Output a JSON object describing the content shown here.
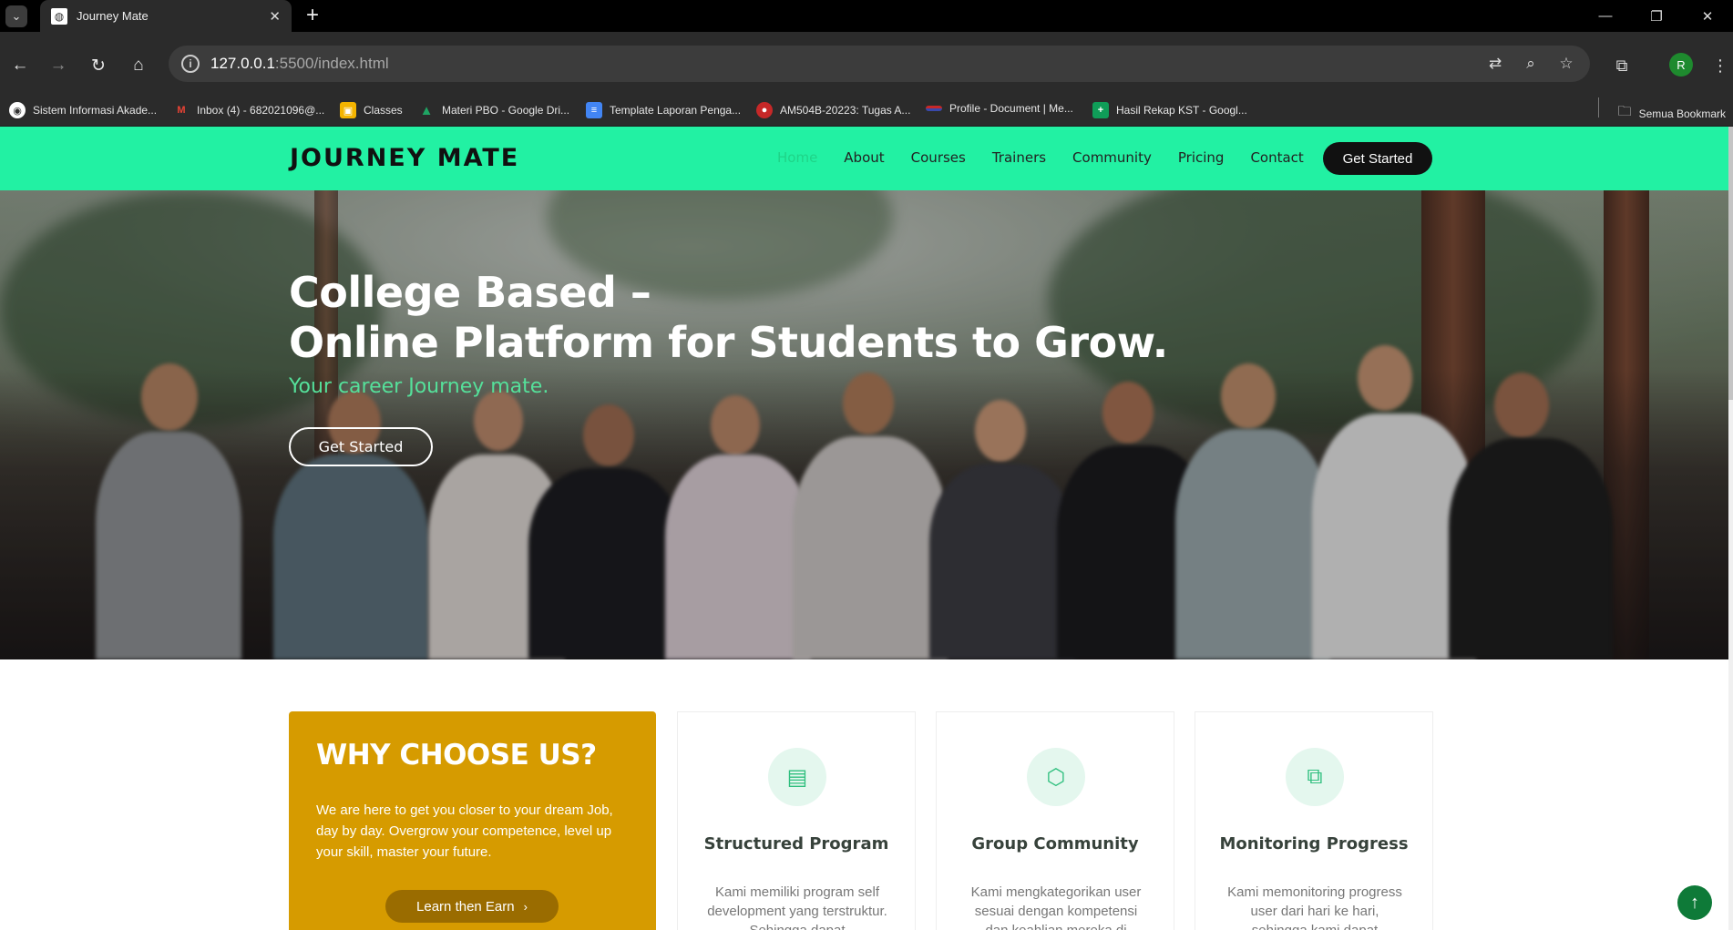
{
  "browser": {
    "tab_title": "Journey Mate",
    "url_host": "127.0.0.1",
    "url_rest": ":5500/index.html",
    "bookmarks": [
      {
        "label": "Sistem Informasi Akade...",
        "icon": "globe-icon",
        "color": "#ffffff"
      },
      {
        "label": "Inbox (4) - 682021096@...",
        "icon": "gmail-icon",
        "color": "#ea4335"
      },
      {
        "label": "Classes",
        "icon": "classroom-icon",
        "color": "#f4b400"
      },
      {
        "label": "Materi PBO - Google Dri...",
        "icon": "drive-icon",
        "color": "#1fa463"
      },
      {
        "label": "Template Laporan Penga...",
        "icon": "docs-icon",
        "color": "#4285f4"
      },
      {
        "label": "AM504B-20223: Tugas A...",
        "icon": "moodle-icon",
        "color": "#c62828"
      },
      {
        "label": "Profile - Document | Me...",
        "icon": "flag-icon",
        "color": "#3949ab"
      },
      {
        "label": "Hasil Rekap KST - Googl...",
        "icon": "sheets-icon",
        "color": "#0f9d58"
      }
    ],
    "bookmarks_folder": "Semua Bookmark",
    "profile_initial": "R"
  },
  "site": {
    "logo": "JOURNEY MATE",
    "nav": [
      "Home",
      "About",
      "Courses",
      "Trainers",
      "Community",
      "Pricing",
      "Contact"
    ],
    "nav_cta": "Get Started",
    "accent": "#22f1a3",
    "hero": {
      "title_line1": "College Based –",
      "title_line2": "Online Platform for Students to Grow.",
      "subtitle": "Your career Journey mate.",
      "button": "Get Started"
    },
    "why": {
      "title": "WHY CHOOSE US?",
      "text": "We are here to get you closer to your dream Job, day by day. Overgrow your competence, level up your skill, master your future.",
      "button": "Learn then Earn",
      "color": "#d69b00"
    },
    "cards": [
      {
        "title": "Structured Program",
        "text": "Kami memiliki program self development yang terstruktur. Sehingga dapat",
        "icon": "document-icon"
      },
      {
        "title": "Group Community",
        "text": "Kami mengkategorikan user sesuai dengan kompetensi dan keahlian mereka di",
        "icon": "hexagon-icon"
      },
      {
        "title": "Monitoring Progress",
        "text": "Kami memonitoring progress user dari hari ke hari, sehingga kami dapat",
        "icon": "images-icon"
      }
    ]
  }
}
